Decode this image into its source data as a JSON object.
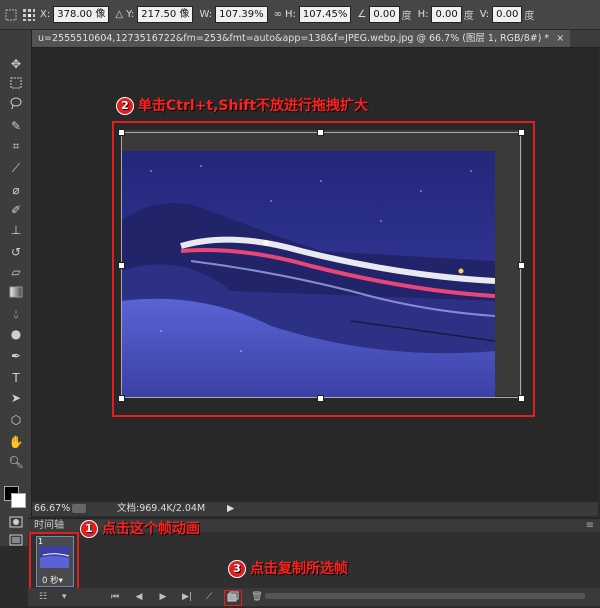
{
  "options_bar": {
    "x_label": "X:",
    "x_value": "378.00 像",
    "y_value": "217.50 像",
    "w_label": "W:",
    "w_value": "107.39%",
    "h_label": "H:",
    "h_value": "107.45%",
    "angle_value": "0.00",
    "angle_unit": "度",
    "hskew_label": "H:",
    "hskew_value": "0.00",
    "hskew_unit": "度",
    "vskew_label": "V:",
    "vskew_value": "0.00",
    "vskew_unit": "度",
    "y_label": "Y:"
  },
  "document_tab": {
    "title": "u=2555510604,1273516722&fm=253&fmt=auto&app=138&f=JPEG.webp.jpg @ 66.7% (图层 1, RGB/8#) *",
    "close": "×"
  },
  "status_bar": {
    "zoom": "66.67%",
    "doc_info": "文档:969.4K/2.04M"
  },
  "timeline": {
    "panel_title": "时间轴",
    "frame_number": "1",
    "frame_delay": "0 秒▾"
  },
  "callouts": {
    "c1_badge": "1",
    "c1_text": "点击这个帧动画",
    "c2_badge": "2",
    "c2_text": "单击Ctrl+t,Shift不放进行拖拽扩大",
    "c3_badge": "3",
    "c3_text": "点击复制所选帧"
  },
  "colors": {
    "annotation_red": "#e02020",
    "ui_dark": "#2b2b2b",
    "photo_blue": "#3a3fb0"
  }
}
